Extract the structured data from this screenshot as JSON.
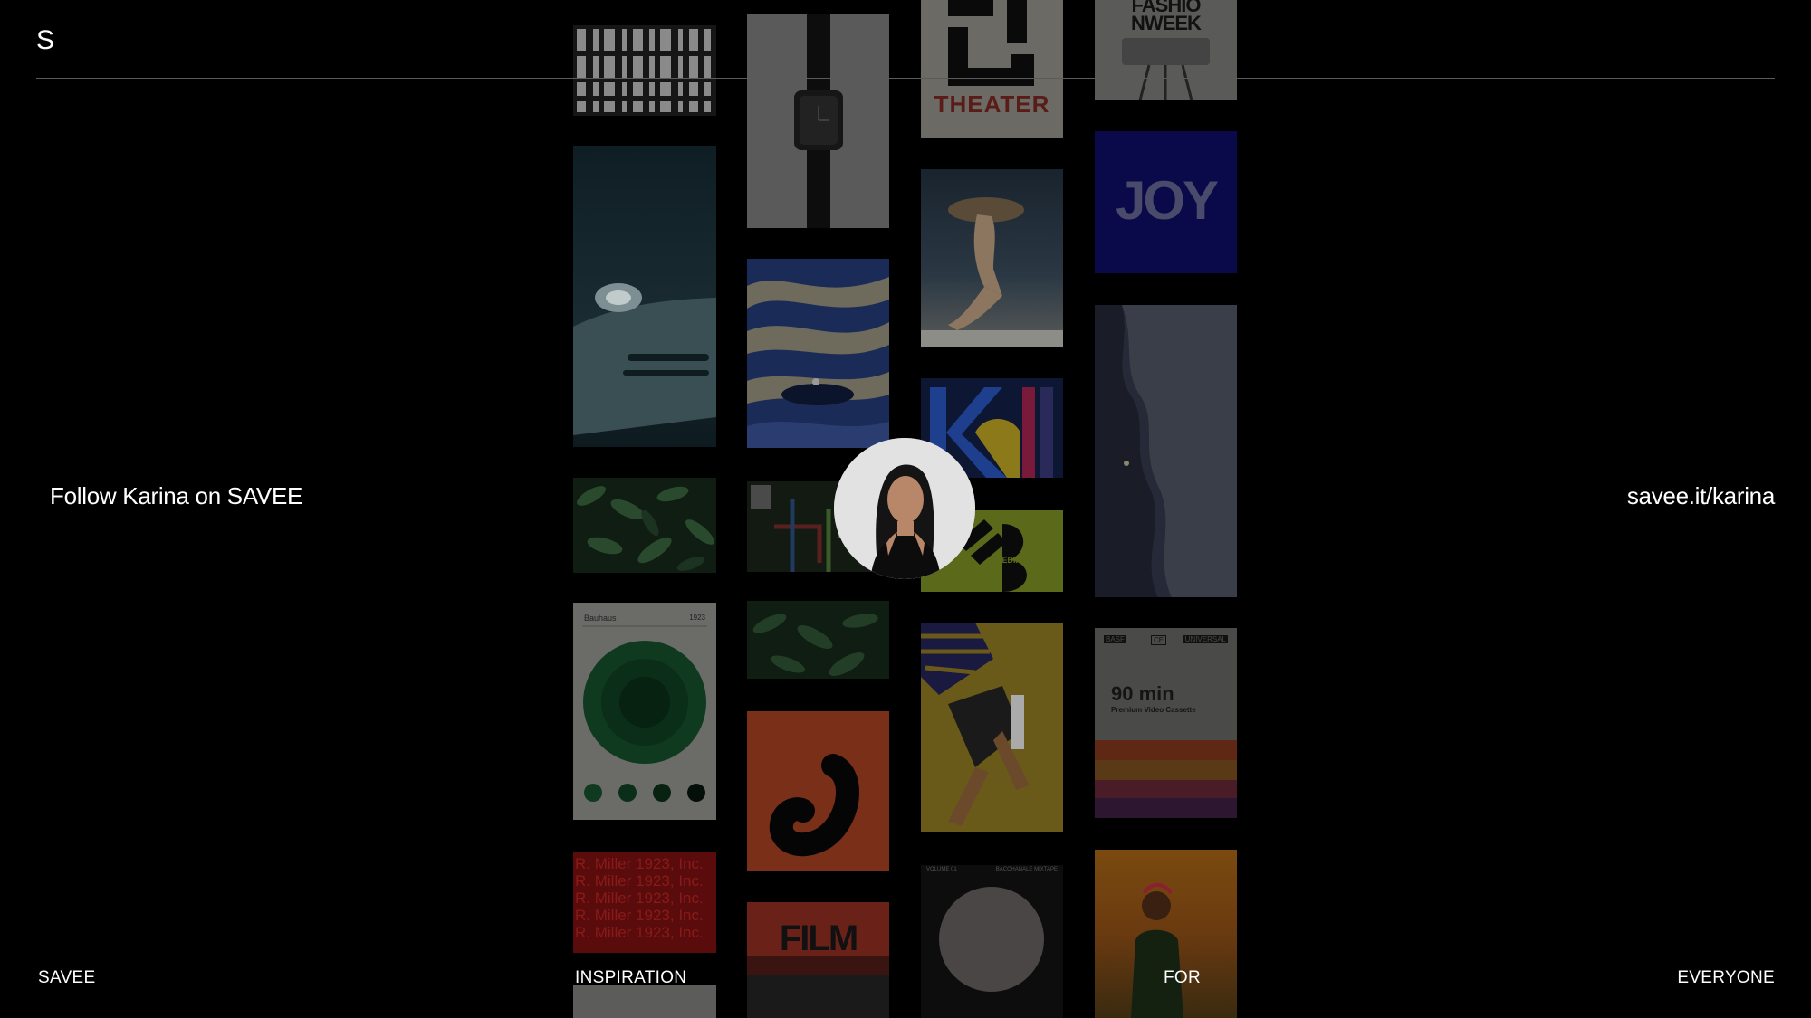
{
  "header": {
    "logo": "S"
  },
  "profile": {
    "follow_text": "Follow Karina on SAVEE",
    "link_text": "savee.it/karina"
  },
  "footer": {
    "word1": "SAVEE",
    "word2": "INSPIRATION",
    "word3": "FOR",
    "word4": "EVERYONE"
  },
  "tiles": {
    "theater": "THEATER",
    "fashion": "FASHIO NWEEK",
    "joy": "JOY",
    "media": "MEDIA",
    "bauhaus": "Bauhaus",
    "bauhaus_num": "1923",
    "vhs_brand": "BASF",
    "vhs_ce": "CE",
    "vhs_universal": "UNIVERSAL",
    "vhs_minutes": "90 min",
    "vhs_sub": "Premium Video Cassette",
    "miller_text": "R. Miller 1923, Inc.",
    "film": "FILM",
    "vinyl_left": "VOLUME 01",
    "vinyl_right": "BACCHANALE MIXTAPE"
  },
  "colors": {
    "background": "#000000",
    "text": "#ffffff",
    "rule": "#5a5a5a"
  }
}
